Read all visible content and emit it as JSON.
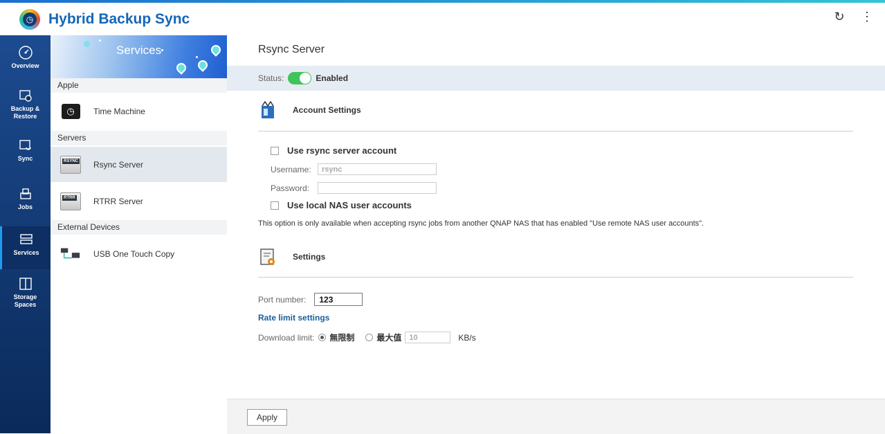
{
  "app": {
    "title": "Hybrid Backup Sync"
  },
  "toolbar": {
    "refresh_icon": "refresh-icon",
    "more_icon": "more-vertical-icon"
  },
  "nav": {
    "items": [
      {
        "label": "Overview",
        "icon": "gauge-icon"
      },
      {
        "label": "Backup &",
        "label2": "Restore",
        "icon": "backup-restore-icon"
      },
      {
        "label": "Sync",
        "icon": "sync-icon"
      },
      {
        "label": "Jobs",
        "icon": "jobs-icon"
      },
      {
        "label": "Services",
        "icon": "services-icon",
        "active": true
      },
      {
        "label": "Storage",
        "label2": "Spaces",
        "icon": "storage-spaces-icon"
      }
    ]
  },
  "services_panel": {
    "banner_title": "Services",
    "groups": [
      {
        "label": "Apple",
        "items": [
          {
            "label": "Time Machine",
            "icon": "time-machine-icon"
          }
        ]
      },
      {
        "label": "Servers",
        "items": [
          {
            "label": "Rsync Server",
            "icon": "rsync-icon",
            "tag": "RSYNC",
            "active": true
          },
          {
            "label": "RTRR Server",
            "icon": "rtrr-icon",
            "tag": "RTRR"
          }
        ]
      },
      {
        "label": "External Devices",
        "items": [
          {
            "label": "USB One Touch Copy",
            "icon": "usb-copy-icon"
          }
        ]
      }
    ]
  },
  "main": {
    "title": "Rsync Server",
    "status_label": "Status:",
    "status_value": "Enabled",
    "account_section": "Account Settings",
    "use_rsync_account": "Use rsync server account",
    "username_label": "Username:",
    "username_value": "rsync",
    "password_label": "Password:",
    "password_value": "",
    "use_local_nas": "Use local NAS user accounts",
    "note": "This option is only available when accepting rsync jobs from another QNAP NAS that has enabled \"Use remote NAS user accounts\".",
    "settings_section": "Settings",
    "port_label": "Port number:",
    "port_value": "123",
    "rate_limit_link": "Rate limit settings",
    "download_limit_label": "Download limit:",
    "option_unlimited": "無限制",
    "option_max": "最大值",
    "max_value": "10",
    "unit": "KB/s"
  },
  "footer": {
    "apply_label": "Apply"
  },
  "colors": {
    "accent": "#1466b8",
    "toggle_on": "#3ec45a",
    "nav_bg": "#0a2a5a",
    "link": "#1a5e9c"
  }
}
